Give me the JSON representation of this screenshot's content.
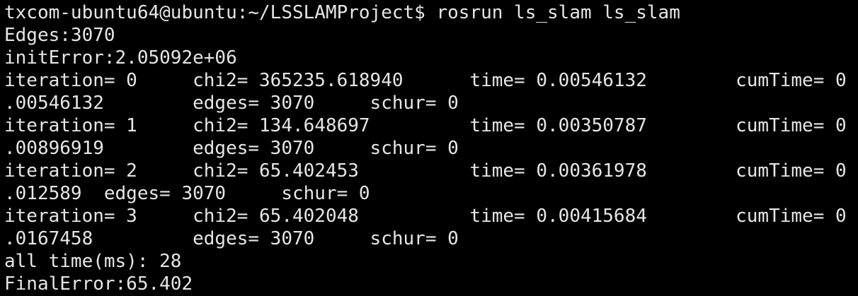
{
  "colors": {
    "background": "#000000",
    "foreground": "#e6e6e6"
  },
  "terminal": {
    "prompt_line": "txcom-ubuntu64@ubuntu:~/LSSLAMProject$ rosrun ls_slam ls_slam",
    "output_lines": [
      "Edges:3070",
      "initError:2.05092e+06",
      "iteration= 0     chi2= 365235.618940      time= 0.00546132        cumTime= 0",
      ".00546132        edges= 3070     schur= 0",
      "iteration= 1     chi2= 134.648697         time= 0.00350787        cumTime= 0",
      ".00896919        edges= 3070     schur= 0",
      "iteration= 2     chi2= 65.402453          time= 0.00361978        cumTime= 0",
      ".012589  edges= 3070     schur= 0",
      "iteration= 3     chi2= 65.402048          time= 0.00415684        cumTime= 0",
      ".0167458         edges= 3070     schur= 0",
      "all time(ms): 28",
      "FinalError:65.402"
    ]
  }
}
